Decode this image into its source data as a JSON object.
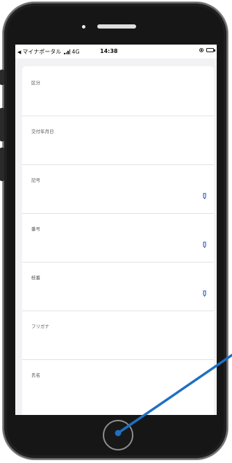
{
  "status_bar": {
    "back_arrow": "◀",
    "carrier": "マイナポータル",
    "network": "4G",
    "time": "14:38",
    "battery_level": 1.0
  },
  "form": {
    "fields": [
      {
        "label": "区分",
        "has_action_icon": false
      },
      {
        "label": "交付年月日",
        "has_action_icon": false
      },
      {
        "label": "記号",
        "has_action_icon": true
      },
      {
        "label": "番号",
        "has_action_icon": true
      },
      {
        "label": "枝番",
        "has_action_icon": true
      },
      {
        "label": "フリガナ",
        "has_action_icon": false
      },
      {
        "label": "氏名",
        "has_action_icon": false
      }
    ]
  },
  "icons": {
    "field_action": "pencil-icon",
    "home": "home-button",
    "annotation": "pointer-line"
  },
  "colors": {
    "annotation": "#1f6fc2",
    "field_icon": "#3f63c8",
    "screen_background": "#f2f2f4"
  }
}
